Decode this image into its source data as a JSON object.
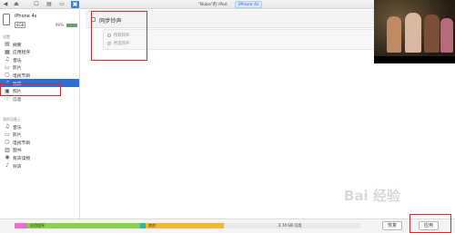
{
  "toolbar": {
    "buttons": [
      "◀",
      "⏏",
      "☐",
      "▤",
      "▭",
      "▣"
    ],
    "library_tab": "\"Bubo\"的 iPod",
    "device_tab": "iPhone 4s"
  },
  "device": {
    "name": "iPhone 4s",
    "capacity": "8GB",
    "battery": "99%",
    "battery_level": 0.99
  },
  "sidebar": {
    "settings_label": "设置",
    "settings_items": [
      {
        "label": "摘要",
        "icon": "summary-icon",
        "glyph": "▤"
      },
      {
        "label": "应用程序",
        "icon": "apps-icon",
        "glyph": "▦"
      },
      {
        "label": "音乐",
        "icon": "music-icon",
        "glyph": "♫"
      },
      {
        "label": "影片",
        "icon": "movie-icon",
        "glyph": "▭"
      },
      {
        "label": "电视节目",
        "icon": "tv-icon",
        "glyph": "▢"
      },
      {
        "label": "铃声",
        "icon": "bell-icon",
        "glyph": "♪"
      },
      {
        "label": "照片",
        "icon": "photo-icon",
        "glyph": "▣"
      },
      {
        "label": "信息",
        "icon": "info-icon",
        "glyph": "ⓘ"
      }
    ],
    "on_device_label": "我的设备上",
    "device_items": [
      {
        "label": "音乐",
        "icon": "music-icon",
        "glyph": "♫"
      },
      {
        "label": "影片",
        "icon": "movie-icon",
        "glyph": "▭"
      },
      {
        "label": "电视节目",
        "icon": "tv-icon",
        "glyph": "▢"
      },
      {
        "label": "图书",
        "icon": "book-icon",
        "glyph": "▥"
      },
      {
        "label": "有声读物",
        "icon": "audiobook-icon",
        "glyph": "◉"
      },
      {
        "label": "铃声",
        "icon": "bell-icon",
        "glyph": "♪"
      }
    ]
  },
  "main": {
    "sync_title": "同步铃声",
    "options": [
      "所有铃声",
      "所选铃声"
    ]
  },
  "storage": {
    "segments": [
      {
        "label": "",
        "color": "#e76fd0"
      },
      {
        "label": "应用程序",
        "color": "#8ad14a"
      },
      {
        "label": "",
        "color": "#2fb7a6"
      },
      {
        "label": "其他",
        "color": "#f3b82b"
      }
    ],
    "free_label": "2.74 GB 可用",
    "revert_label": "恢复",
    "apply_label": "应用"
  },
  "watermark": "Bai 经验",
  "colors": {
    "accent": "#2f6fd3",
    "highlight": "#e0242b"
  }
}
